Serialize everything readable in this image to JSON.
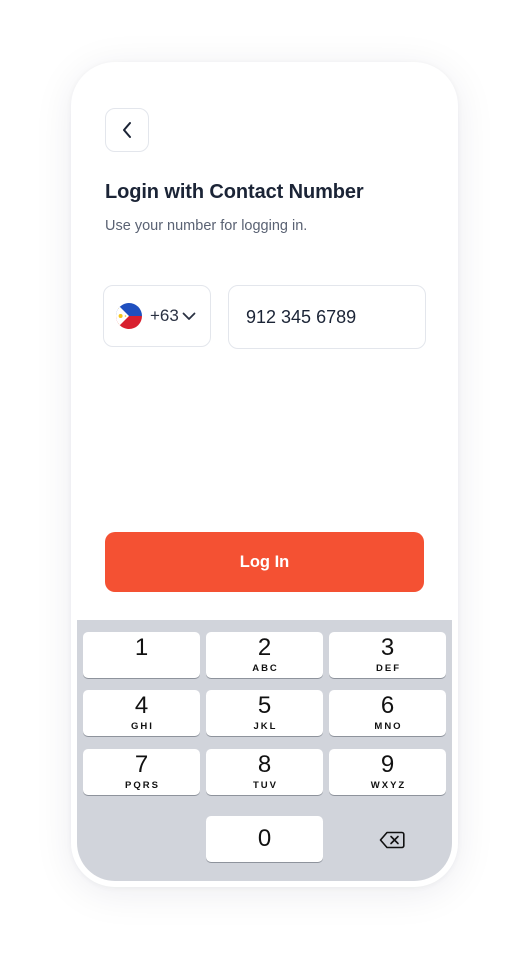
{
  "header": {
    "title": "Login with Contact Number",
    "subtitle": "Use your number for logging in."
  },
  "country": {
    "flag": "philippines-flag",
    "dial_code": "+63"
  },
  "phone": {
    "value": "912 345 6789"
  },
  "login_button": {
    "label": "Log In"
  },
  "colors": {
    "accent": "#f45133",
    "title": "#1b2436",
    "keypad_bg": "#d1d4db"
  },
  "keypad": {
    "keys": [
      {
        "digit": "1",
        "letters": ""
      },
      {
        "digit": "2",
        "letters": "ABC"
      },
      {
        "digit": "3",
        "letters": "DEF"
      },
      {
        "digit": "4",
        "letters": "GHI"
      },
      {
        "digit": "5",
        "letters": "JKL"
      },
      {
        "digit": "6",
        "letters": "MNO"
      },
      {
        "digit": "7",
        "letters": "PQRS"
      },
      {
        "digit": "8",
        "letters": "TUV"
      },
      {
        "digit": "9",
        "letters": "WXYZ"
      },
      {
        "digit": "0",
        "letters": ""
      }
    ],
    "backspace_icon": "backspace-icon"
  }
}
